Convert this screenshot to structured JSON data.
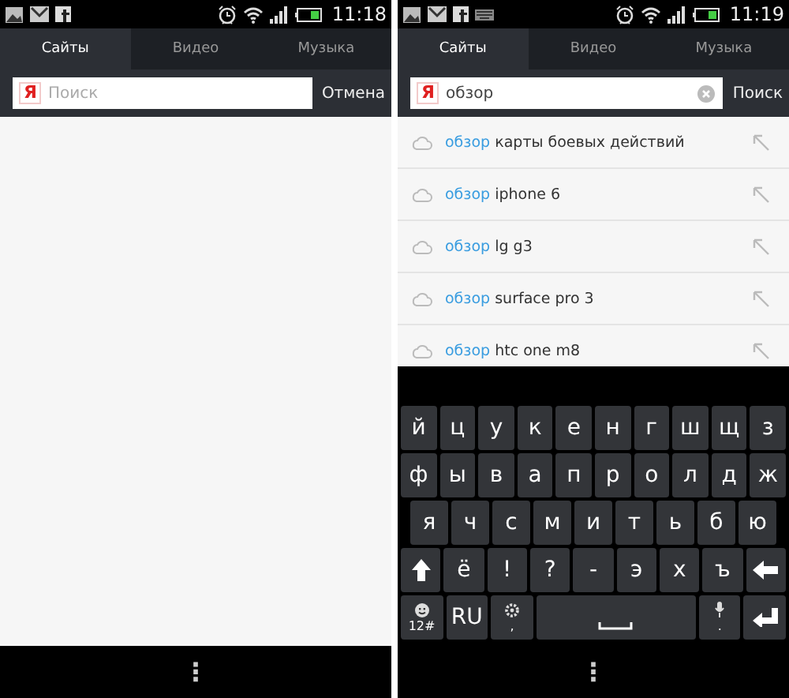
{
  "screens": [
    {
      "status_bar": {
        "time": "11:18",
        "keyboard_notification": false
      },
      "tabs": [
        {
          "label": "Сайты",
          "selected": true
        },
        {
          "label": "Видео",
          "selected": false
        },
        {
          "label": "Музыка",
          "selected": false
        }
      ],
      "search": {
        "logo": "Я",
        "placeholder": "Поиск",
        "clear_button": false,
        "action": "Отмена"
      },
      "nav_bar": {
        "menu": "⋮"
      }
    },
    {
      "status_bar": {
        "time": "11:19",
        "keyboard_notification": true
      },
      "tabs": [
        {
          "label": "Сайты",
          "selected": true
        },
        {
          "label": "Видео",
          "selected": false
        },
        {
          "label": "Музыка",
          "selected": false
        }
      ],
      "search": {
        "logo": "Я",
        "value": "обзор",
        "clear_button": true,
        "action": "Поиск"
      },
      "suggestions": [
        {
          "match": "обзор",
          "rest": "карты боевых действий"
        },
        {
          "match": "обзор",
          "rest": "iphone 6"
        },
        {
          "match": "обзор",
          "rest": "lg g3"
        },
        {
          "match": "обзор",
          "rest": "surface pro 3"
        },
        {
          "match": "обзор",
          "rest": "htc one m8"
        }
      ],
      "keyboard": {
        "rows": [
          [
            {
              "kind": "char",
              "label": "й"
            },
            {
              "kind": "char",
              "label": "ц"
            },
            {
              "kind": "char",
              "label": "у"
            },
            {
              "kind": "char",
              "label": "к"
            },
            {
              "kind": "char",
              "label": "е"
            },
            {
              "kind": "char",
              "label": "н"
            },
            {
              "kind": "char",
              "label": "г"
            },
            {
              "kind": "char",
              "label": "ш"
            },
            {
              "kind": "char",
              "label": "щ"
            },
            {
              "kind": "char",
              "label": "з"
            }
          ],
          [
            {
              "kind": "char",
              "label": "ф"
            },
            {
              "kind": "char",
              "label": "ы"
            },
            {
              "kind": "char",
              "label": "в"
            },
            {
              "kind": "char",
              "label": "а"
            },
            {
              "kind": "char",
              "label": "п"
            },
            {
              "kind": "char",
              "label": "р"
            },
            {
              "kind": "char",
              "label": "о"
            },
            {
              "kind": "char",
              "label": "л"
            },
            {
              "kind": "char",
              "label": "д"
            },
            {
              "kind": "char",
              "label": "ж"
            }
          ],
          [
            {
              "kind": "char",
              "label": "я"
            },
            {
              "kind": "char",
              "label": "ч"
            },
            {
              "kind": "char",
              "label": "с"
            },
            {
              "kind": "char",
              "label": "м"
            },
            {
              "kind": "char",
              "label": "и"
            },
            {
              "kind": "char",
              "label": "т"
            },
            {
              "kind": "char",
              "label": "ь"
            },
            {
              "kind": "char",
              "label": "б"
            },
            {
              "kind": "char",
              "label": "ю"
            }
          ],
          [
            {
              "kind": "shift"
            },
            {
              "kind": "char",
              "label": "ё"
            },
            {
              "kind": "char",
              "label": "!"
            },
            {
              "kind": "char",
              "label": "?"
            },
            {
              "kind": "char",
              "label": "-"
            },
            {
              "kind": "char",
              "label": "э"
            },
            {
              "kind": "char",
              "label": "х"
            },
            {
              "kind": "char",
              "label": "ъ"
            },
            {
              "kind": "backspace"
            }
          ],
          [
            {
              "kind": "emoji",
              "label": "12#"
            },
            {
              "kind": "char",
              "label": "RU"
            },
            {
              "kind": "gear",
              "label": ","
            },
            {
              "kind": "space"
            },
            {
              "kind": "mic",
              "label": "."
            },
            {
              "kind": "enter"
            }
          ]
        ]
      },
      "nav_bar": {
        "menu": "⋮"
      }
    }
  ]
}
